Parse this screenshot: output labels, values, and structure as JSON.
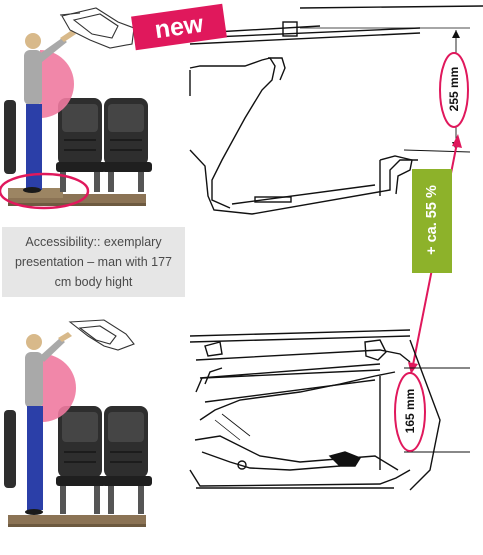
{
  "badge": {
    "new_label": "new"
  },
  "caption": {
    "text": "Accessibility:: exemplary presentation – man with 177 cm body hight"
  },
  "dimensions": {
    "upper_label": "255 mm",
    "lower_label": "165 mm",
    "increase_label": "+ ca. 55 %"
  },
  "colors": {
    "accent_pink": "#e0185c",
    "increase_green": "#8db22a",
    "caption_bg": "#e6e6e6",
    "person_shirt": "#a9a9a9",
    "person_pants": "#2b3fa8",
    "reach_arc": "#f07aa0",
    "seat": "#2e2e2e",
    "floor": "#8b7355"
  },
  "icons": {
    "person": "standing-person-figure",
    "seat": "aircraft-seat-row",
    "bin": "overhead-bin-drawing"
  }
}
